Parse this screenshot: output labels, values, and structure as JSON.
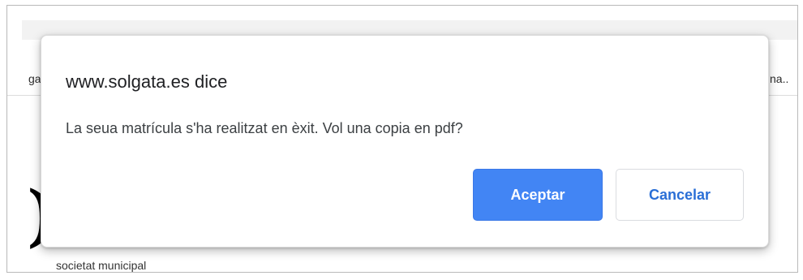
{
  "background": {
    "left_fragment": "ga",
    "right_fragment": "na..",
    "logo_glyph": ")",
    "caption": "societat municipal"
  },
  "dialog": {
    "title": "www.solgata.es dice",
    "message": "La seua matrícula s'ha realitzat en èxit. Vol una copia en pdf?",
    "accept_label": "Aceptar",
    "cancel_label": "Cancelar"
  },
  "colors": {
    "accent": "#4285f4",
    "cancel_text": "#2a6fd6"
  }
}
